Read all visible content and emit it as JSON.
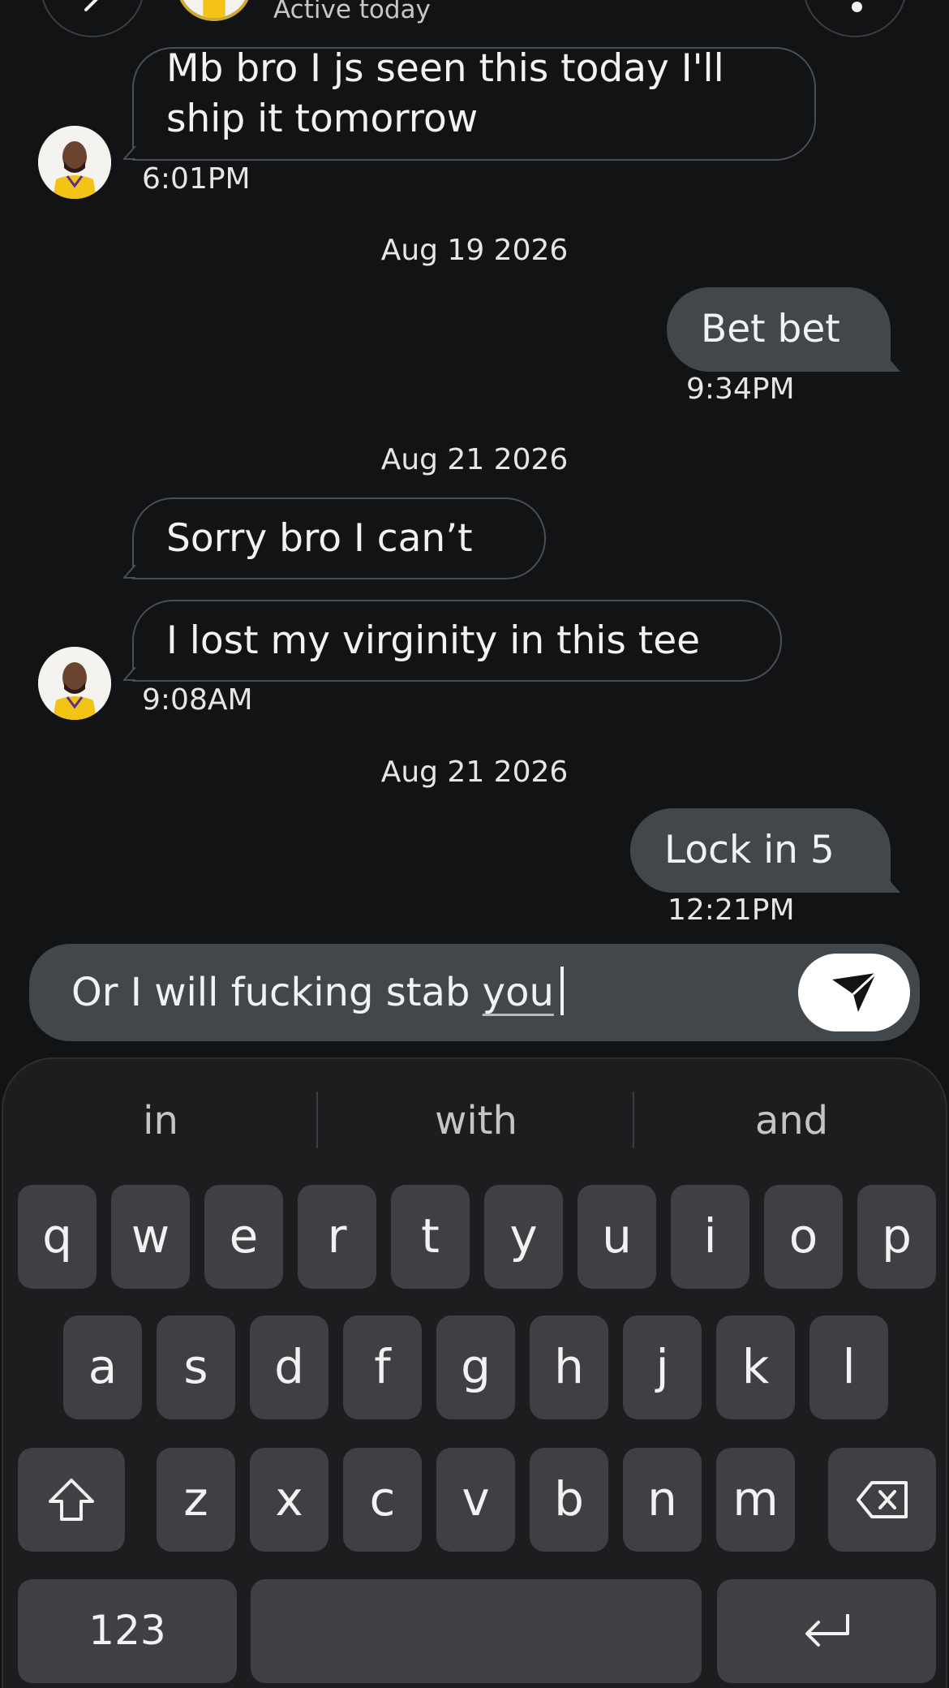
{
  "header": {
    "status": "Active today",
    "back_icon": "chevron-left-icon",
    "menu_icon": "more-vertical-icon"
  },
  "messages": [
    {
      "direction": "incoming",
      "lines": [
        "Mb bro I js seen this today I'll",
        "ship it tomorrow"
      ],
      "time": "6:01PM"
    },
    {
      "date": "Aug 19 2026"
    },
    {
      "direction": "outgoing",
      "text": "Bet bet",
      "time": "9:34PM"
    },
    {
      "date": "Aug 21 2026"
    },
    {
      "direction": "incoming",
      "text": "Sorry bro I can’t"
    },
    {
      "direction": "incoming",
      "text": "I lost my virginity in this tee",
      "time": "9:08AM"
    },
    {
      "date": "Aug 21 2026"
    },
    {
      "direction": "outgoing",
      "text": "Lock in 5",
      "time": "12:21PM"
    }
  ],
  "composer": {
    "text_before": "Or I will fucking stab ",
    "text_composing": "you",
    "send_icon": "send-icon"
  },
  "keyboard": {
    "suggestions": [
      "in",
      "with",
      "and"
    ],
    "row1": [
      "q",
      "w",
      "e",
      "r",
      "t",
      "y",
      "u",
      "i",
      "o",
      "p"
    ],
    "row2": [
      "a",
      "s",
      "d",
      "f",
      "g",
      "h",
      "j",
      "k",
      "l"
    ],
    "row3": [
      "z",
      "x",
      "c",
      "v",
      "b",
      "n",
      "m"
    ],
    "numbers_label": "123",
    "shift_icon": "shift-icon",
    "backspace_icon": "backspace-icon",
    "enter_icon": "enter-icon"
  },
  "colors": {
    "background": "#121314",
    "outgoing_bubble": "#42474b",
    "key": "#3f4043",
    "avatar_jersey": "#f3c316"
  }
}
